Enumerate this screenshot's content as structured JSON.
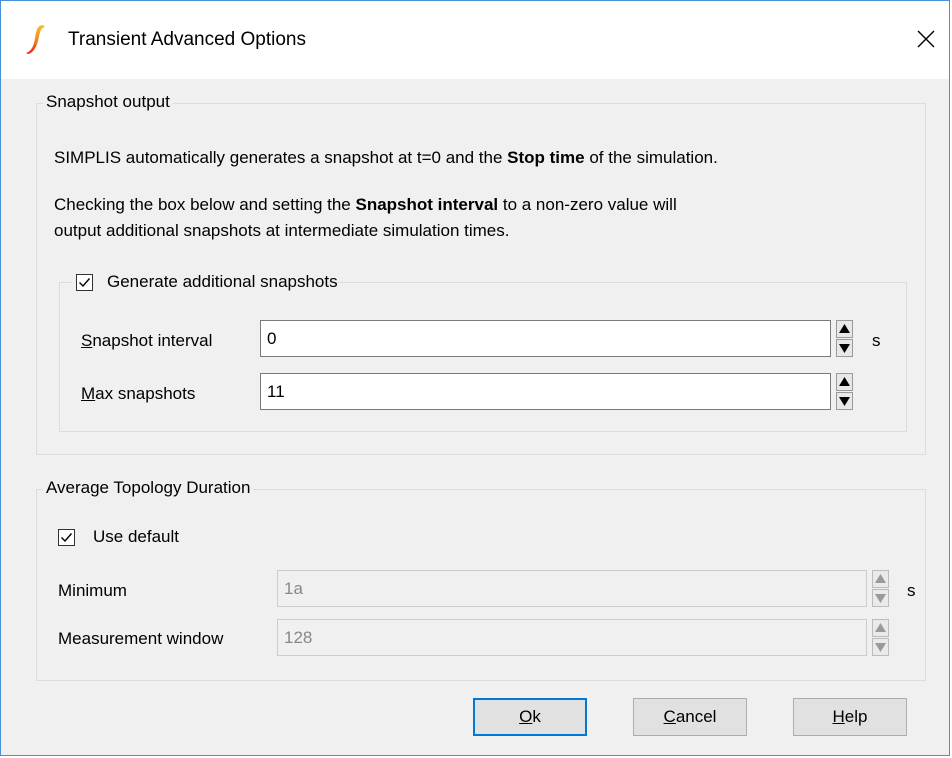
{
  "window": {
    "title": "Transient Advanced Options",
    "close_glyph": "✕"
  },
  "snapshot": {
    "group_title": "Snapshot output",
    "desc1_pre": "SIMPLIS automatically generates a snapshot at t=0 and the ",
    "desc1_bold": "Stop time",
    "desc1_post": " of the simulation.",
    "desc2_pre": "Checking the box below and setting the ",
    "desc2_bold": "Snapshot interval",
    "desc2_post": " to a non-zero value will",
    "desc3": "output additional snapshots at intermediate simulation times.",
    "additional": {
      "checkbox_label": "Generate additional snapshots",
      "checked": true,
      "interval_mnemonic": "S",
      "interval_label_rest": "napshot interval",
      "interval_value": "0",
      "interval_unit": "s",
      "max_mnemonic": "M",
      "max_label_rest": "ax snapshots",
      "max_value": "11"
    }
  },
  "topology": {
    "group_title": "Average Topology Duration",
    "use_default_label": "Use default",
    "use_default_checked": true,
    "minimum_label": "Minimum",
    "minimum_value": "1a",
    "minimum_unit": "s",
    "window_label": "Measurement window",
    "window_value": "128"
  },
  "buttons": {
    "ok_mnemonic": "O",
    "ok_rest": "k",
    "cancel_mnemonic": "C",
    "cancel_rest": "ancel",
    "help_mnemonic": "H",
    "help_rest": "elp"
  },
  "colors": {
    "accent": "#0078d7",
    "icon_top": "#f7c12a",
    "icon_bottom": "#e2231a"
  },
  "icons": {
    "app": "simplis-logo-icon",
    "close": "close-icon",
    "check": "checkmark-icon",
    "spin_up": "arrow-up-icon",
    "spin_down": "arrow-down-icon"
  }
}
